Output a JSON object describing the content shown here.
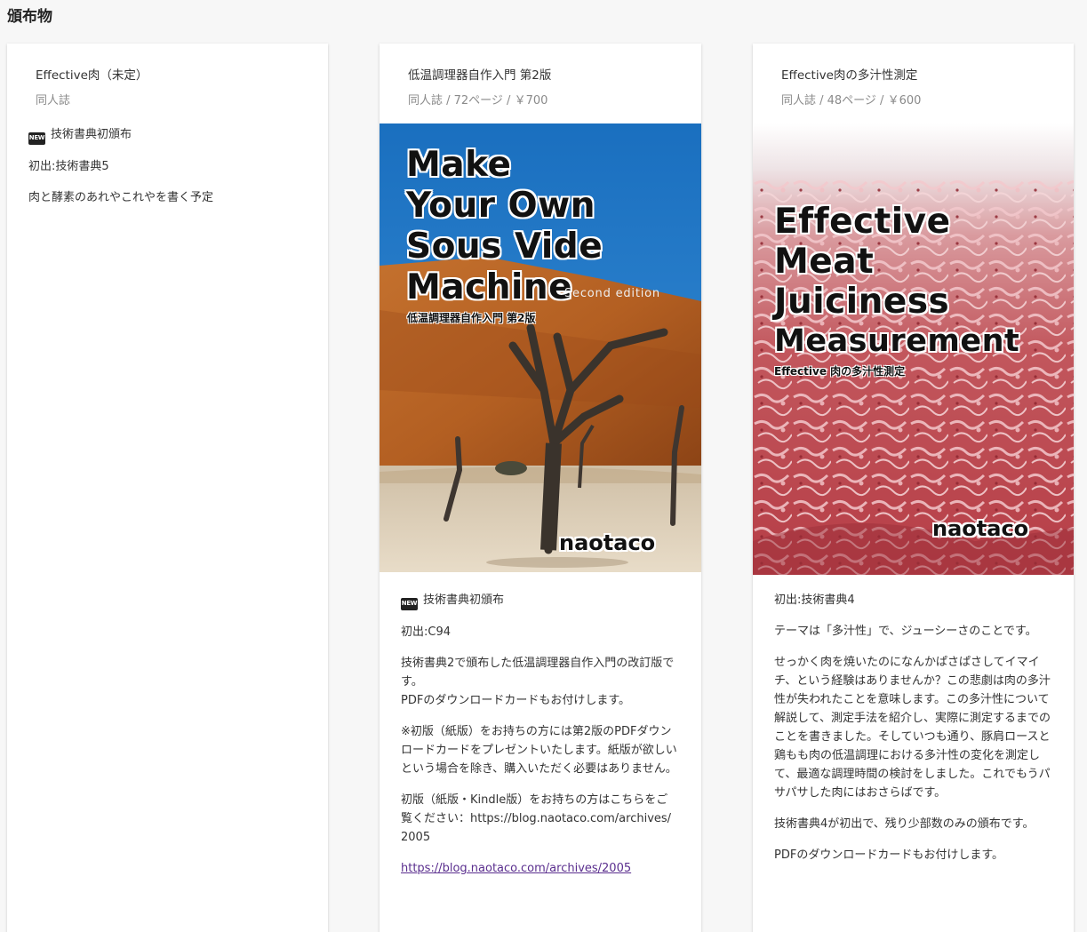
{
  "page_title": "頒布物",
  "badge_label": "NEW",
  "cards": [
    {
      "title": "Effective肉（未定）",
      "subtitle": "同人誌",
      "new_text": "技術書典初頒布",
      "first_appearance": "初出:技術書典5",
      "paragraphs": [
        "肉と酵素のあれやこれやを書く予定"
      ]
    },
    {
      "title": "低温調理器自作入門 第2版",
      "subtitle": "同人誌 / 72ページ / ￥700",
      "cover": {
        "title_lines": [
          "Make",
          "Your Own",
          "Sous Vide",
          "Machine"
        ],
        "edition": "Second edition",
        "subtitle": "低温調理器自作入門 第2版",
        "author": "naotaco"
      },
      "new_text": "技術書典初頒布",
      "first_appearance": "初出:C94",
      "paragraphs": [
        "技術書典2で頒布した低温調理器自作入門の改訂版です。",
        "PDFのダウンロードカードもお付けします。",
        "※初版（紙版）をお持ちの方には第2版のPDFダウンロードカードをプレゼントいたします。紙版が欲しいという場合を除き、購入いただく必要はありません。",
        "初版（紙版・Kindle版）をお持ちの方はこちらをご覧ください：https://blog.naotaco.com/archives/2005"
      ],
      "link": "https://blog.naotaco.com/archives/2005"
    },
    {
      "title": "Effective肉の多汁性測定",
      "subtitle": "同人誌 / 48ページ / ￥600",
      "cover": {
        "title_lines": [
          "Effective",
          "Meat",
          "Juiciness",
          "Measurement"
        ],
        "subtitle": "Effective 肉の多汁性測定",
        "author": "naotaco"
      },
      "first_appearance": "初出:技術書典4",
      "paragraphs": [
        "テーマは「多汁性」で、ジューシーさのことです。",
        "せっかく肉を焼いたのになんかぱさぱさしてイマイチ、という経験はありませんか？この悲劇は肉の多汁性が失われたことを意味します。この多汁性について解説して、測定手法を紹介し、実際に測定するまでのことを書きました。そしていつも通り、豚肩ロースと鶏もも肉の低温調理における多汁性の変化を測定して、最適な調理時間の検討をしました。これでもうパサパサした肉にはおさらばです。",
        "技術書典4が初出で、残り少部数のみの頒布です。",
        "PDFのダウンロードカードもお付けします。"
      ]
    }
  ]
}
